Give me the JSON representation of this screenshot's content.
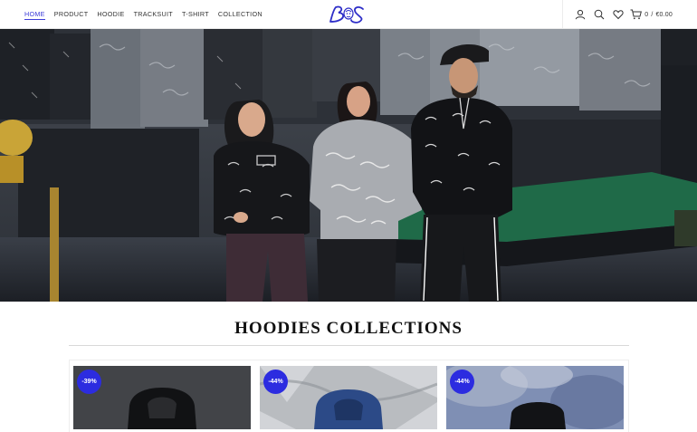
{
  "nav": {
    "items": [
      {
        "label": "HOME",
        "active": true
      },
      {
        "label": "PRODUCT",
        "active": false
      },
      {
        "label": "HOODIE",
        "active": false
      },
      {
        "label": "TRACKSUIT",
        "active": false
      },
      {
        "label": "T-SHIRT",
        "active": false
      },
      {
        "label": "COLLECTION",
        "active": false
      }
    ]
  },
  "logo": {
    "text": "BS"
  },
  "header_tools": {
    "icons": [
      "user-icon",
      "search-icon",
      "heart-icon",
      "cart-icon"
    ],
    "cart_count": "0",
    "cart_separator": "/",
    "cart_total": "€0.00"
  },
  "hero": {
    "alt": "Three models wearing printed hoodies in a clothing store with a pool table"
  },
  "section": {
    "title": "HOODIES COLLECTIONS"
  },
  "products": [
    {
      "badge": "-39%"
    },
    {
      "badge": "-44%"
    },
    {
      "badge": "-44%"
    }
  ],
  "colors": {
    "accent": "#3b3bd8",
    "badge": "#2c2ce0"
  }
}
